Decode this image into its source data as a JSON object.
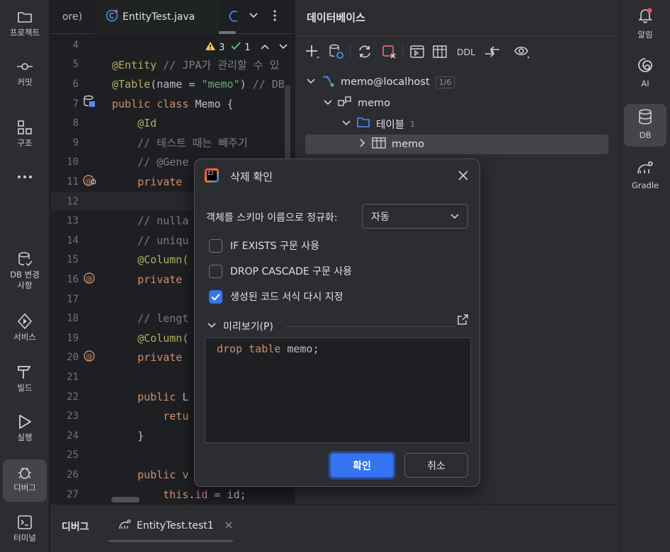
{
  "left_strip": {
    "items": [
      {
        "label": "프로젝트",
        "icon": "folder-icon"
      },
      {
        "label": "커밋",
        "icon": "commit-icon"
      },
      {
        "label": "구조",
        "icon": "structure-icon"
      },
      {
        "label": "",
        "icon": "more-icon"
      },
      {
        "label": "DB 변경 사항",
        "icon": "db-changes-icon"
      },
      {
        "label": "서비스",
        "icon": "services-icon"
      },
      {
        "label": "빌드",
        "icon": "build-icon"
      },
      {
        "label": "실행",
        "icon": "run-icon"
      },
      {
        "label": "디버그",
        "icon": "debug-icon"
      },
      {
        "label": "터미널",
        "icon": "terminal-icon"
      }
    ]
  },
  "right_strip": {
    "items": [
      {
        "label": "알림",
        "icon": "bell-icon"
      },
      {
        "label": "AI",
        "icon": "ai-icon"
      },
      {
        "label": "DB",
        "icon": "database-icon"
      },
      {
        "label": "Gradle",
        "icon": "gradle-icon"
      }
    ]
  },
  "editor": {
    "tabs": [
      {
        "label": "ore)"
      },
      {
        "label": "EntityTest.java"
      }
    ],
    "inspections": {
      "warnings": "3",
      "ok": "1"
    },
    "lines": [
      {
        "num": "4",
        "html": ""
      },
      {
        "num": "5",
        "html": "<span class='an'>@Entity</span> <span class='cm'>// JPA가 관리할 수 있</span>"
      },
      {
        "num": "6",
        "html": "<span class='an'>@Table</span><span class='id'>(name = </span><span class='st'>\"memo\"</span><span class='id'>) </span><span class='cm'>// DB</span>"
      },
      {
        "num": "7",
        "html": "<span class='kw'>public class </span><span class='id'>Memo {</span>"
      },
      {
        "num": "8",
        "html": "    <span class='an'>@Id</span>"
      },
      {
        "num": "9",
        "html": "    <span class='cm'>// 테스트 때는 빼주기</span>"
      },
      {
        "num": "10",
        "html": "    <span class='cm'>// @Gene</span>"
      },
      {
        "num": "11",
        "html": "    <span class='kw'>private</span>"
      },
      {
        "num": "12",
        "html": ""
      },
      {
        "num": "13",
        "html": "    <span class='cm'>// nulla</span>"
      },
      {
        "num": "14",
        "html": "    <span class='cm'>// uniqu</span>"
      },
      {
        "num": "15",
        "html": "    <span class='an'>@Column(</span>"
      },
      {
        "num": "16",
        "html": "    <span class='kw'>private</span>"
      },
      {
        "num": "17",
        "html": ""
      },
      {
        "num": "18",
        "html": "    <span class='cm'>// lengt</span>"
      },
      {
        "num": "19",
        "html": "    <span class='an'>@Column(</span>"
      },
      {
        "num": "20",
        "html": "    <span class='kw'>private</span>"
      },
      {
        "num": "21",
        "html": ""
      },
      {
        "num": "22",
        "html": "    <span class='kw'>public </span><span class='id'>L</span>"
      },
      {
        "num": "23",
        "html": "        <span class='kw'>retu</span>"
      },
      {
        "num": "24",
        "html": "    <span class='id'>}</span>"
      },
      {
        "num": "25",
        "html": ""
      },
      {
        "num": "26",
        "html": "    <span class='kw'>public v</span>"
      },
      {
        "num": "27",
        "html": "        <span class='kw'>this</span><span class='id'>.</span><span class='fd'>id</span><span class='id'> = id;</span>"
      }
    ]
  },
  "db_panel": {
    "title": "데이터베이스",
    "toolbar": {
      "ddl_label": "DDL"
    },
    "tree": {
      "datasource": "memo@localhost",
      "datasource_badge": "1/6",
      "schema": "memo",
      "folder": "테이블",
      "folder_count": "1",
      "table": "memo"
    }
  },
  "bottom": {
    "title": "디버그",
    "tab_label": "EntityTest.test1"
  },
  "dialog": {
    "title": "삭제 확인",
    "logo_text": "IJ",
    "normalize_label": "객체를 스키마 이름으로 정규화:",
    "normalize_value": "자동",
    "checkboxes": [
      {
        "label": "IF EXISTS 구문 사용",
        "checked": false
      },
      {
        "label": "DROP CASCADE 구문 사용",
        "checked": false
      },
      {
        "label": "생성된 코드 서식 다시 지정",
        "checked": true
      }
    ],
    "preview_label": "미리보기(P)",
    "preview_code": "drop table memo;",
    "ok_label": "확인",
    "cancel_label": "취소"
  },
  "colors": {
    "accent": "#3574f0",
    "keyword": "#cf8e6d",
    "annotation": "#b3ae60",
    "string": "#6aab73",
    "comment": "#7a7e85"
  }
}
